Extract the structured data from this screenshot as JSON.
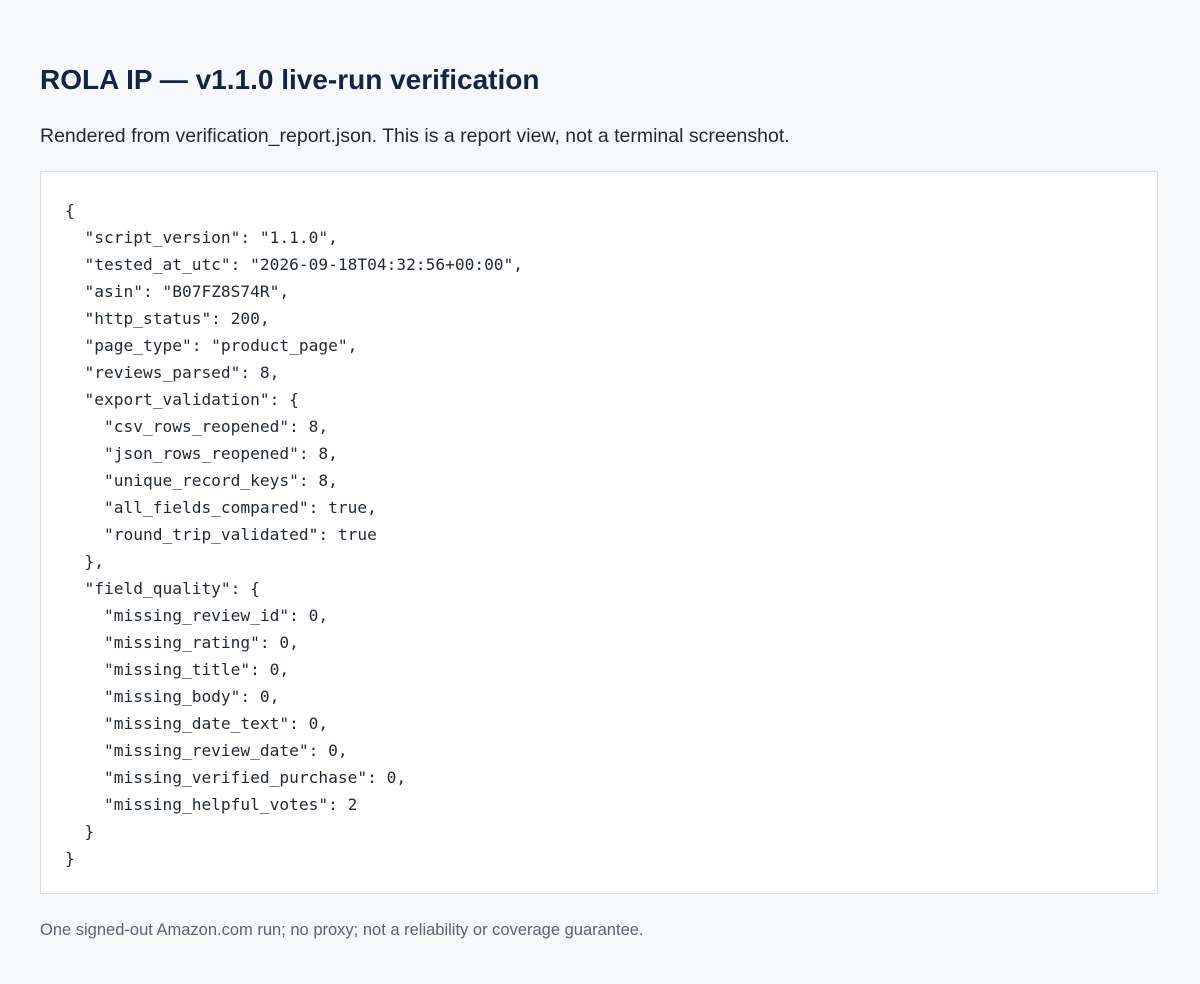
{
  "header": {
    "title": "ROLA IP — v1.1.0 live-run verification",
    "subtitle": "Rendered from verification_report.json. This is a report view, not a terminal screenshot."
  },
  "report": {
    "lines": [
      "{",
      "  \"script_version\": \"1.1.0\",",
      "  \"tested_at_utc\": \"2026-09-18T04:32:56+00:00\",",
      "  \"asin\": \"B07FZ8S74R\",",
      "  \"http_status\": 200,",
      "  \"page_type\": \"product_page\",",
      "  \"reviews_parsed\": 8,",
      "  \"export_validation\": {",
      "    \"csv_rows_reopened\": 8,",
      "    \"json_rows_reopened\": 8,",
      "    \"unique_record_keys\": 8,",
      "    \"all_fields_compared\": true,",
      "    \"round_trip_validated\": true",
      "  },",
      "  \"field_quality\": {",
      "    \"missing_review_id\": 0,",
      "    \"missing_rating\": 0,",
      "    \"missing_title\": 0,",
      "    \"missing_body\": 0,",
      "    \"missing_date_text\": 0,",
      "    \"missing_review_date\": 0,",
      "    \"missing_verified_purchase\": 0,",
      "    \"missing_helpful_votes\": 2",
      "  }",
      "}"
    ]
  },
  "footer": {
    "note": "One signed-out Amazon.com run; no proxy; not a reliability or coverage guarantee."
  },
  "colors": {
    "background": "#f6f8fa",
    "title": "#142447",
    "panel": "#ffffff",
    "panel_border": "#dcdfe4",
    "muted_text": "#5b6470"
  }
}
